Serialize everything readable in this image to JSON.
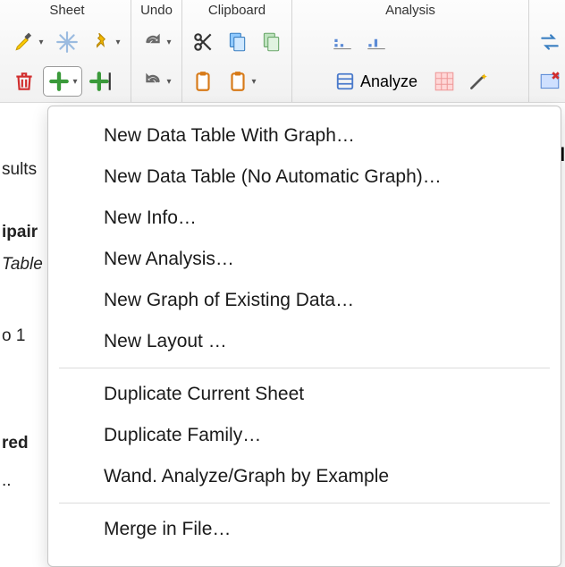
{
  "toolbar": {
    "groups": {
      "sheet": {
        "label": "Sheet"
      },
      "undo": {
        "label": "Undo"
      },
      "clipboard": {
        "label": "Clipboard"
      },
      "analysis": {
        "label": "Analysis",
        "analyze_label": "Analyze"
      }
    }
  },
  "left": {
    "results": "sults",
    "pair": "ipair",
    "table": "Table",
    "row1": "o 1",
    "red": "red ",
    "dots": ".."
  },
  "menu": {
    "items": [
      "New Data Table With Graph…",
      "New Data Table (No Automatic Graph)…",
      "New Info…",
      "New Analysis…",
      "New Graph of Existing Data…",
      "New Layout …",
      "Duplicate Current Sheet",
      "Duplicate Family…",
      "Wand. Analyze/Graph by Example",
      "Merge in File…"
    ]
  }
}
